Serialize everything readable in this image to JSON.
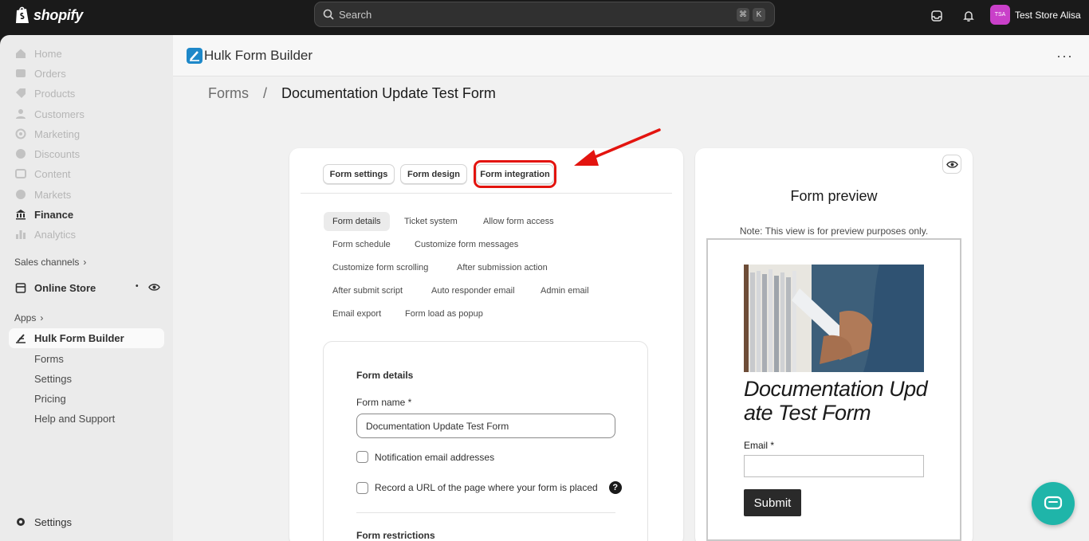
{
  "topbar": {
    "brand": "shopify",
    "search_placeholder": "Search",
    "shortcut_cmd": "⌘",
    "shortcut_key": "K",
    "store_initials": "TSA",
    "store_name": "Test Store Alisa"
  },
  "sidebar": {
    "items": [
      {
        "label": "Home",
        "icon": "home-icon"
      },
      {
        "label": "Orders",
        "icon": "orders-icon"
      },
      {
        "label": "Products",
        "icon": "tag-icon"
      },
      {
        "label": "Customers",
        "icon": "person-icon"
      },
      {
        "label": "Marketing",
        "icon": "target-icon"
      },
      {
        "label": "Discounts",
        "icon": "discount-icon"
      },
      {
        "label": "Content",
        "icon": "content-icon"
      },
      {
        "label": "Markets",
        "icon": "globe-icon"
      },
      {
        "label": "Finance",
        "icon": "bank-icon"
      },
      {
        "label": "Analytics",
        "icon": "bar-chart-icon"
      }
    ],
    "sales_channels_label": "Sales channels",
    "online_store_label": "Online Store",
    "apps_label": "Apps",
    "app_name": "Hulk Form Builder",
    "app_subitems": [
      "Forms",
      "Settings",
      "Pricing",
      "Help and Support"
    ],
    "settings_label": "Settings"
  },
  "app": {
    "title": "Hulk Form Builder",
    "more_label": "···"
  },
  "breadcrumb": {
    "parent": "Forms",
    "separator": "/",
    "current": "Documentation Update Test Form"
  },
  "tabs": [
    "Form settings",
    "Form design",
    "Form integration"
  ],
  "subtabs": [
    "Form details",
    "Ticket system",
    "Allow form access",
    "Form schedule",
    "Customize form messages",
    "Customize form scrolling",
    "After submission action",
    "After submit script",
    "Auto responder email",
    "Admin email",
    "Email export",
    "Form load as popup"
  ],
  "form_details": {
    "title": "Form details",
    "name_label": "Form name *",
    "name_value": "Documentation Update Test Form",
    "notification_label": "Notification email addresses",
    "record_url_label": "Record a URL of the page where your form is placed",
    "help_glyph": "?",
    "restrictions_title": "Form restrictions"
  },
  "preview": {
    "title": "Form preview",
    "note": "Note: This view is for preview purposes only.",
    "form_heading": "Documentation Update Test Form",
    "email_label": "Email *",
    "submit_label": "Submit"
  },
  "colors": {
    "highlight": "#e3140f",
    "chat": "#1fb5a9",
    "avatar": "#c940c9"
  }
}
